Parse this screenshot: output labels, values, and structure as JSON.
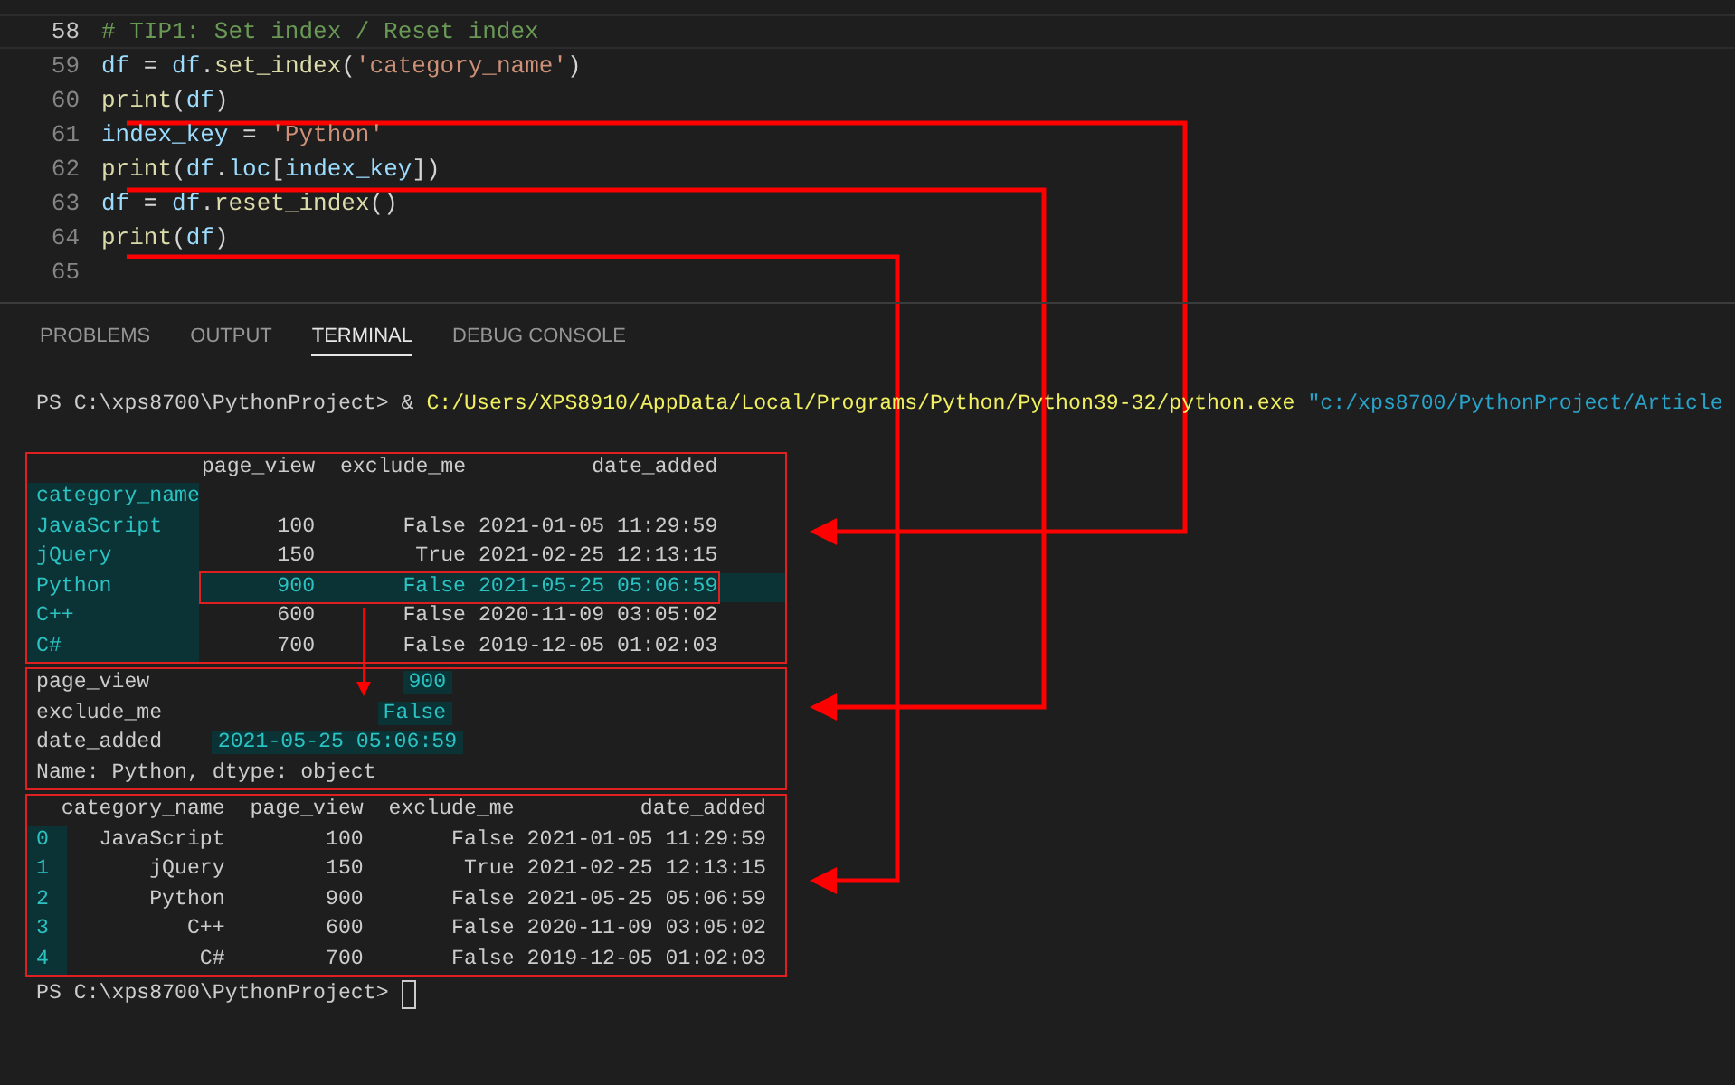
{
  "editor": {
    "lines": [
      {
        "number": "58",
        "active": true,
        "tokens": [
          {
            "text": "# TIP1: Set index / Reset index",
            "kind": "comment"
          }
        ]
      },
      {
        "number": "59",
        "active": false,
        "tokens": [
          {
            "text": "df",
            "kind": "variable"
          },
          {
            "text": " = ",
            "kind": "plain"
          },
          {
            "text": "df",
            "kind": "variable"
          },
          {
            "text": ".",
            "kind": "plain"
          },
          {
            "text": "set_index",
            "kind": "function"
          },
          {
            "text": "(",
            "kind": "plain"
          },
          {
            "text": "'category_name'",
            "kind": "string"
          },
          {
            "text": ")",
            "kind": "plain"
          }
        ]
      },
      {
        "number": "60",
        "active": false,
        "tokens": [
          {
            "text": "print",
            "kind": "function"
          },
          {
            "text": "(",
            "kind": "plain"
          },
          {
            "text": "df",
            "kind": "variable"
          },
          {
            "text": ")",
            "kind": "plain"
          }
        ]
      },
      {
        "number": "61",
        "active": false,
        "tokens": [
          {
            "text": "index_key",
            "kind": "variable"
          },
          {
            "text": " = ",
            "kind": "plain"
          },
          {
            "text": "'Python'",
            "kind": "string"
          }
        ]
      },
      {
        "number": "62",
        "active": false,
        "tokens": [
          {
            "text": "print",
            "kind": "function"
          },
          {
            "text": "(",
            "kind": "plain"
          },
          {
            "text": "df",
            "kind": "variable"
          },
          {
            "text": ".",
            "kind": "plain"
          },
          {
            "text": "loc",
            "kind": "variable"
          },
          {
            "text": "[",
            "kind": "plain"
          },
          {
            "text": "index_key",
            "kind": "variable"
          },
          {
            "text": "])",
            "kind": "plain"
          }
        ]
      },
      {
        "number": "63",
        "active": false,
        "tokens": [
          {
            "text": "df",
            "kind": "variable"
          },
          {
            "text": " = ",
            "kind": "plain"
          },
          {
            "text": "df",
            "kind": "variable"
          },
          {
            "text": ".",
            "kind": "plain"
          },
          {
            "text": "reset_index",
            "kind": "function"
          },
          {
            "text": "()",
            "kind": "plain"
          }
        ]
      },
      {
        "number": "64",
        "active": false,
        "tokens": [
          {
            "text": "print",
            "kind": "function"
          },
          {
            "text": "(",
            "kind": "plain"
          },
          {
            "text": "df",
            "kind": "variable"
          },
          {
            "text": ")",
            "kind": "plain"
          }
        ]
      },
      {
        "number": "65",
        "active": false
      }
    ]
  },
  "panel_tabs": [
    {
      "label": "PROBLEMS",
      "selected": false
    },
    {
      "label": "OUTPUT",
      "selected": false
    },
    {
      "label": "TERMINAL",
      "selected": true
    },
    {
      "label": "DEBUG CONSOLE",
      "selected": false
    }
  ],
  "terminal": {
    "command": {
      "prompt": "PS C:\\xps8700\\PythonProject>",
      "operator": "&",
      "program": "C:/Users/XPS8910/AppData/Local/Programs/Python/Python39-32/python.exe",
      "argument": "\"c:/xps8700/PythonProject/Article"
    },
    "set_index_output": {
      "columns": [
        "page_view",
        "exclude_me",
        "date_added"
      ],
      "index_name": "category_name",
      "rows": [
        {
          "index": "JavaScript",
          "cells": [
            "100",
            "False",
            "2021-01-05 11:29:59"
          ],
          "highlighted": false
        },
        {
          "index": "jQuery",
          "cells": [
            "150",
            "True",
            "2021-02-25 12:13:15"
          ],
          "highlighted": false
        },
        {
          "index": "Python",
          "cells": [
            "900",
            "False",
            "2021-05-25 05:06:59"
          ],
          "highlighted": true
        },
        {
          "index": "C++",
          "cells": [
            "600",
            "False",
            "2020-11-09 03:05:02"
          ],
          "highlighted": false
        },
        {
          "index": "C#",
          "cells": [
            "700",
            "False",
            "2019-12-05 01:02:03"
          ],
          "highlighted": false
        }
      ]
    },
    "series_output": {
      "items": [
        {
          "label": "page_view",
          "value": "900"
        },
        {
          "label": "exclude_me",
          "value": "False"
        },
        {
          "label": "date_added",
          "value": "2021-05-25 05:06:59"
        }
      ],
      "footer": "Name: Python, dtype: object"
    },
    "reset_output": {
      "columns": [
        "category_name",
        "page_view",
        "exclude_me",
        "date_added"
      ],
      "rows": [
        {
          "index": "0",
          "cells": [
            "JavaScript",
            "100",
            "False",
            "2021-01-05 11:29:59"
          ]
        },
        {
          "index": "1",
          "cells": [
            "jQuery",
            "150",
            "True",
            "2021-02-25 12:13:15"
          ]
        },
        {
          "index": "2",
          "cells": [
            "Python",
            "900",
            "False",
            "2021-05-25 05:06:59"
          ]
        },
        {
          "index": "3",
          "cells": [
            "C++",
            "600",
            "False",
            "2020-11-09 03:05:02"
          ]
        },
        {
          "index": "4",
          "cells": [
            "C#",
            "700",
            "False",
            "2019-12-05 01:02:03"
          ]
        }
      ]
    },
    "prompt": "PS C:\\xps8700\\PythonProject>"
  }
}
